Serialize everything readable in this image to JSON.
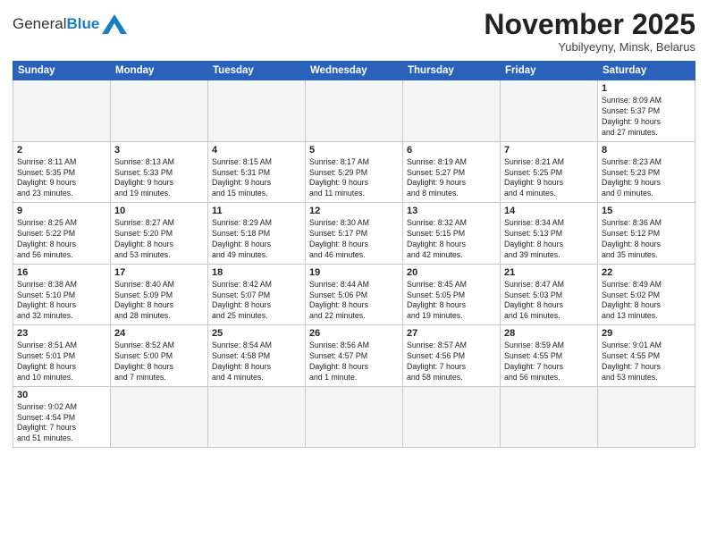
{
  "header": {
    "logo_general": "General",
    "logo_blue": "Blue",
    "month_title": "November 2025",
    "subtitle": "Yubilyeyny, Minsk, Belarus"
  },
  "weekdays": [
    "Sunday",
    "Monday",
    "Tuesday",
    "Wednesday",
    "Thursday",
    "Friday",
    "Saturday"
  ],
  "weeks": [
    [
      {
        "day": "",
        "info": ""
      },
      {
        "day": "",
        "info": ""
      },
      {
        "day": "",
        "info": ""
      },
      {
        "day": "",
        "info": ""
      },
      {
        "day": "",
        "info": ""
      },
      {
        "day": "",
        "info": ""
      },
      {
        "day": "1",
        "info": "Sunrise: 8:09 AM\nSunset: 5:37 PM\nDaylight: 9 hours\nand 27 minutes."
      }
    ],
    [
      {
        "day": "2",
        "info": "Sunrise: 8:11 AM\nSunset: 5:35 PM\nDaylight: 9 hours\nand 23 minutes."
      },
      {
        "day": "3",
        "info": "Sunrise: 8:13 AM\nSunset: 5:33 PM\nDaylight: 9 hours\nand 19 minutes."
      },
      {
        "day": "4",
        "info": "Sunrise: 8:15 AM\nSunset: 5:31 PM\nDaylight: 9 hours\nand 15 minutes."
      },
      {
        "day": "5",
        "info": "Sunrise: 8:17 AM\nSunset: 5:29 PM\nDaylight: 9 hours\nand 11 minutes."
      },
      {
        "day": "6",
        "info": "Sunrise: 8:19 AM\nSunset: 5:27 PM\nDaylight: 9 hours\nand 8 minutes."
      },
      {
        "day": "7",
        "info": "Sunrise: 8:21 AM\nSunset: 5:25 PM\nDaylight: 9 hours\nand 4 minutes."
      },
      {
        "day": "8",
        "info": "Sunrise: 8:23 AM\nSunset: 5:23 PM\nDaylight: 9 hours\nand 0 minutes."
      }
    ],
    [
      {
        "day": "9",
        "info": "Sunrise: 8:25 AM\nSunset: 5:22 PM\nDaylight: 8 hours\nand 56 minutes."
      },
      {
        "day": "10",
        "info": "Sunrise: 8:27 AM\nSunset: 5:20 PM\nDaylight: 8 hours\nand 53 minutes."
      },
      {
        "day": "11",
        "info": "Sunrise: 8:29 AM\nSunset: 5:18 PM\nDaylight: 8 hours\nand 49 minutes."
      },
      {
        "day": "12",
        "info": "Sunrise: 8:30 AM\nSunset: 5:17 PM\nDaylight: 8 hours\nand 46 minutes."
      },
      {
        "day": "13",
        "info": "Sunrise: 8:32 AM\nSunset: 5:15 PM\nDaylight: 8 hours\nand 42 minutes."
      },
      {
        "day": "14",
        "info": "Sunrise: 8:34 AM\nSunset: 5:13 PM\nDaylight: 8 hours\nand 39 minutes."
      },
      {
        "day": "15",
        "info": "Sunrise: 8:36 AM\nSunset: 5:12 PM\nDaylight: 8 hours\nand 35 minutes."
      }
    ],
    [
      {
        "day": "16",
        "info": "Sunrise: 8:38 AM\nSunset: 5:10 PM\nDaylight: 8 hours\nand 32 minutes."
      },
      {
        "day": "17",
        "info": "Sunrise: 8:40 AM\nSunset: 5:09 PM\nDaylight: 8 hours\nand 28 minutes."
      },
      {
        "day": "18",
        "info": "Sunrise: 8:42 AM\nSunset: 5:07 PM\nDaylight: 8 hours\nand 25 minutes."
      },
      {
        "day": "19",
        "info": "Sunrise: 8:44 AM\nSunset: 5:06 PM\nDaylight: 8 hours\nand 22 minutes."
      },
      {
        "day": "20",
        "info": "Sunrise: 8:45 AM\nSunset: 5:05 PM\nDaylight: 8 hours\nand 19 minutes."
      },
      {
        "day": "21",
        "info": "Sunrise: 8:47 AM\nSunset: 5:03 PM\nDaylight: 8 hours\nand 16 minutes."
      },
      {
        "day": "22",
        "info": "Sunrise: 8:49 AM\nSunset: 5:02 PM\nDaylight: 8 hours\nand 13 minutes."
      }
    ],
    [
      {
        "day": "23",
        "info": "Sunrise: 8:51 AM\nSunset: 5:01 PM\nDaylight: 8 hours\nand 10 minutes."
      },
      {
        "day": "24",
        "info": "Sunrise: 8:52 AM\nSunset: 5:00 PM\nDaylight: 8 hours\nand 7 minutes."
      },
      {
        "day": "25",
        "info": "Sunrise: 8:54 AM\nSunset: 4:58 PM\nDaylight: 8 hours\nand 4 minutes."
      },
      {
        "day": "26",
        "info": "Sunrise: 8:56 AM\nSunset: 4:57 PM\nDaylight: 8 hours\nand 1 minute."
      },
      {
        "day": "27",
        "info": "Sunrise: 8:57 AM\nSunset: 4:56 PM\nDaylight: 7 hours\nand 58 minutes."
      },
      {
        "day": "28",
        "info": "Sunrise: 8:59 AM\nSunset: 4:55 PM\nDaylight: 7 hours\nand 56 minutes."
      },
      {
        "day": "29",
        "info": "Sunrise: 9:01 AM\nSunset: 4:55 PM\nDaylight: 7 hours\nand 53 minutes."
      }
    ],
    [
      {
        "day": "30",
        "info": "Sunrise: 9:02 AM\nSunset: 4:54 PM\nDaylight: 7 hours\nand 51 minutes."
      },
      {
        "day": "",
        "info": ""
      },
      {
        "day": "",
        "info": ""
      },
      {
        "day": "",
        "info": ""
      },
      {
        "day": "",
        "info": ""
      },
      {
        "day": "",
        "info": ""
      },
      {
        "day": "",
        "info": ""
      }
    ]
  ]
}
